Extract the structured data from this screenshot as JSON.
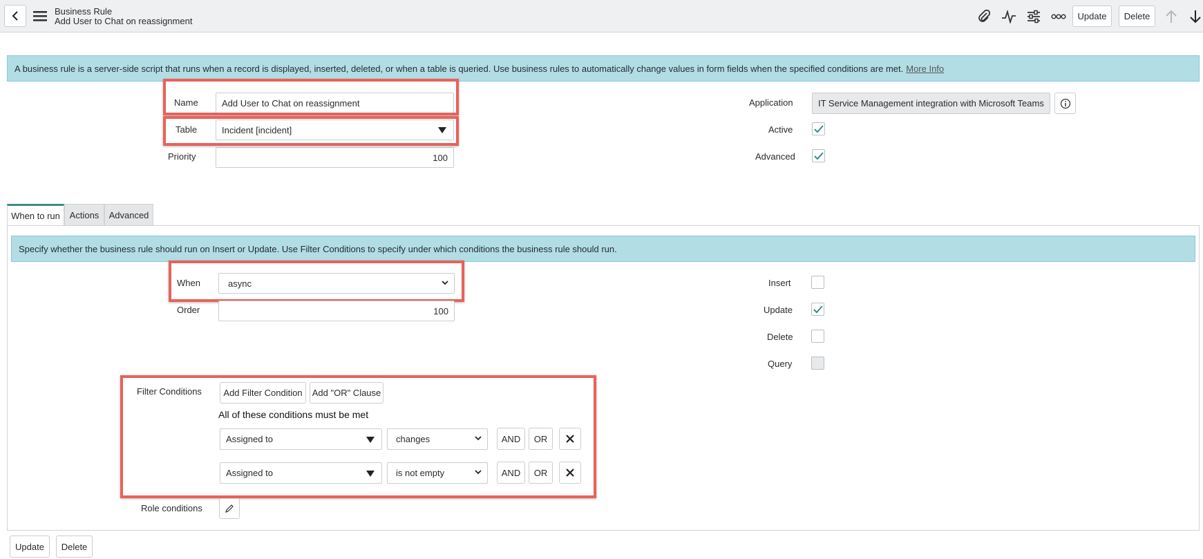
{
  "header": {
    "title": "Business Rule",
    "subtitle": "Add User to Chat on reassignment",
    "update_label": "Update",
    "delete_label": "Delete"
  },
  "info": {
    "text": "A business rule is a server-side script that runs when a record is displayed, inserted, deleted, or when a table is queried. Use business rules to automatically change values in form fields when the specified conditions are met.",
    "link": "More Info"
  },
  "form": {
    "name_label": "Name",
    "name_value": "Add User to Chat on reassignment",
    "table_label": "Table",
    "table_value": "Incident [incident]",
    "priority_label": "Priority",
    "priority_value": "100",
    "application_label": "Application",
    "application_value": "IT Service Management integration with Microsoft Teams",
    "active_label": "Active",
    "active_checked": true,
    "advanced_label": "Advanced",
    "advanced_checked": true
  },
  "tabs": [
    {
      "label": "When to run",
      "active": true
    },
    {
      "label": "Actions",
      "active": false
    },
    {
      "label": "Advanced",
      "active": false
    }
  ],
  "when_to_run": {
    "info_pre": "Specify whether the business rule should run on ",
    "info_insert": "Insert",
    "info_or": " or ",
    "info_update": "Update",
    "info_mid": ". Use ",
    "info_filter": "Filter Conditions",
    "info_post": " to specify under which conditions the business rule should run.",
    "when_label": "When",
    "when_value": "async",
    "order_label": "Order",
    "order_value": "100",
    "insert_label": "Insert",
    "insert_checked": false,
    "update_label": "Update",
    "update_checked": true,
    "delete_label": "Delete",
    "delete_checked": false,
    "query_label": "Query",
    "query_checked": false,
    "filter_label": "Filter Conditions",
    "add_filter_label": "Add Filter Condition",
    "add_or_label": "Add \"OR\" Clause",
    "conditions_heading": "All of these conditions must be met",
    "conditions": [
      {
        "field": "Assigned to",
        "operator": "changes",
        "and": "AND",
        "or": "OR"
      },
      {
        "field": "Assigned to",
        "operator": "is not empty",
        "and": "AND",
        "or": "OR"
      }
    ],
    "role_label": "Role conditions"
  },
  "footer": {
    "update_label": "Update",
    "delete_label": "Delete"
  },
  "colors": {
    "accent": "#3b8a8c",
    "info_bg": "#b3dde5",
    "highlight": "#e8625a",
    "header_bg": "#eef0f1"
  }
}
